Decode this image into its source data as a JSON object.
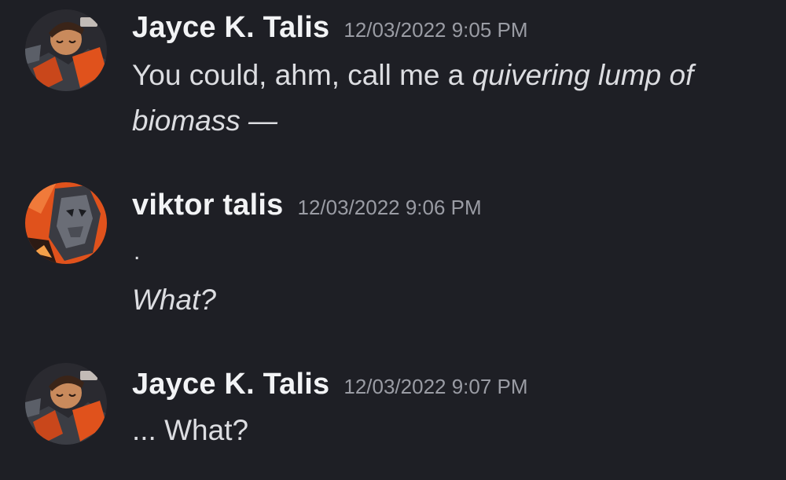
{
  "messages": [
    {
      "author": "Jayce K. Talis",
      "timestamp": "12/03/2022 9:05 PM",
      "avatar_icon": "jayce-avatar",
      "text_plain": "You could, ahm, call me a ",
      "text_italic": "quivering lump of",
      "text_line2_italic": "biomass —"
    },
    {
      "author": "viktor talis",
      "timestamp": "12/03/2022 9:06 PM",
      "avatar_icon": "viktor-avatar",
      "line1": ".",
      "line2_italic": "What?"
    },
    {
      "author": "Jayce K. Talis",
      "timestamp": "12/03/2022 9:07 PM",
      "avatar_icon": "jayce-avatar",
      "line1": "... What?"
    }
  ],
  "colors": {
    "background": "#1e1f25",
    "author": "#f2f3f5",
    "timestamp": "#9a9ca4",
    "text": "#dcdde1",
    "avatar_orange": "#e0521c",
    "avatar_dark": "#2a2a30"
  }
}
